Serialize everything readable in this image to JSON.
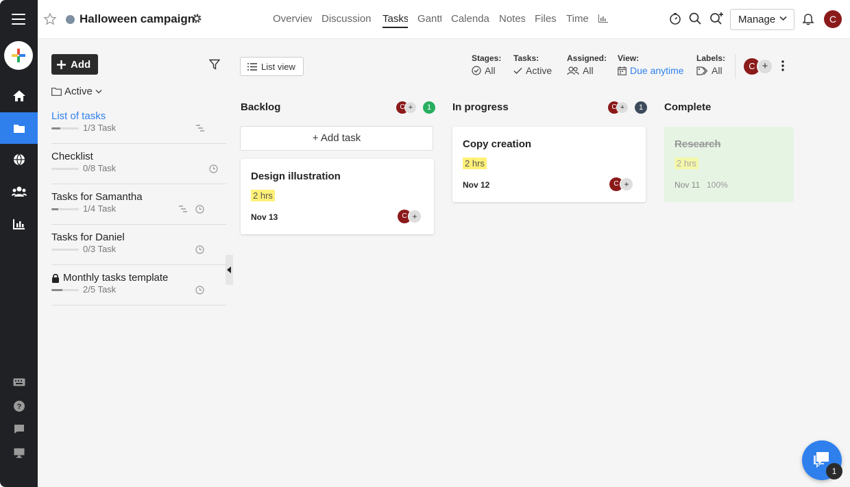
{
  "project": {
    "title": "Halloween campaign",
    "dot_color": "#7d8fa0"
  },
  "tabs": [
    {
      "label": "Overview"
    },
    {
      "label": "Discussion"
    },
    {
      "label": "Tasks"
    },
    {
      "label": "Gantt"
    },
    {
      "label": "Calendar"
    },
    {
      "label": "Notes"
    },
    {
      "label": "Files"
    },
    {
      "label": "Time"
    }
  ],
  "header": {
    "manage_label": "Manage",
    "avatar_initial": "C"
  },
  "sidebar_rail": {
    "icons": [
      "menu-icon",
      "new-icon",
      "home-icon",
      "projects-icon",
      "globe-icon",
      "people-icon",
      "reports-icon",
      "keyboard-icon",
      "help-icon",
      "feedback-icon",
      "desktop-icon"
    ],
    "active": "projects-icon",
    "accent": "#2f80ed"
  },
  "lists_panel": {
    "add_label": "Add",
    "status_filter": "Active",
    "items": [
      {
        "name": "List of tasks",
        "count": "1/3 Task",
        "progress": 0.33,
        "selected": true,
        "locked": false
      },
      {
        "name": "Checklist",
        "count": "0/8 Task",
        "progress": 0,
        "selected": false,
        "locked": false
      },
      {
        "name": "Tasks for Samantha",
        "count": "1/4 Task",
        "progress": 0.25,
        "selected": false,
        "locked": false
      },
      {
        "name": "Tasks for Daniel",
        "count": "0/3 Task",
        "progress": 0,
        "selected": false,
        "locked": false
      },
      {
        "name": "Monthly tasks template",
        "count": "2/5 Task",
        "progress": 0.4,
        "selected": false,
        "locked": true
      }
    ]
  },
  "board": {
    "view_label": "List view",
    "filters": [
      {
        "label": "Stages:",
        "value": "All",
        "icon": "check-circle-icon"
      },
      {
        "label": "Tasks:",
        "value": "Active",
        "icon": "check-icon"
      },
      {
        "label": "Assigned:",
        "value": "All",
        "icon": "people-icon"
      },
      {
        "label": "View:",
        "value": "Due anytime",
        "icon": "calendar-icon"
      },
      {
        "label": "Labels:",
        "value": "All",
        "icon": "tag-icon"
      }
    ],
    "avatar_initial": "C",
    "add_task_label": "+ Add task",
    "columns": [
      {
        "name": "Backlog",
        "count": "1",
        "count_color": "#27ae60",
        "cards": [
          {
            "title": "Design illustration",
            "estimate": "2 hrs",
            "due": "Nov 13",
            "assignee": "C"
          }
        ]
      },
      {
        "name": "In progress",
        "count": "1",
        "count_color": "#3d4a5c",
        "cards": [
          {
            "title": "Copy creation",
            "estimate": "2 hrs",
            "due": "Nov 12",
            "assignee": "C"
          }
        ]
      },
      {
        "name": "Complete",
        "cards": [
          {
            "title": "Research",
            "estimate": "2 hrs",
            "due": "Nov 11",
            "percent": "100%"
          }
        ]
      }
    ]
  },
  "chat": {
    "badge": "1"
  },
  "colors": {
    "avatar": "#8b1a1a",
    "highlight": "#fff176",
    "complete_card": "#e6f4e4"
  }
}
